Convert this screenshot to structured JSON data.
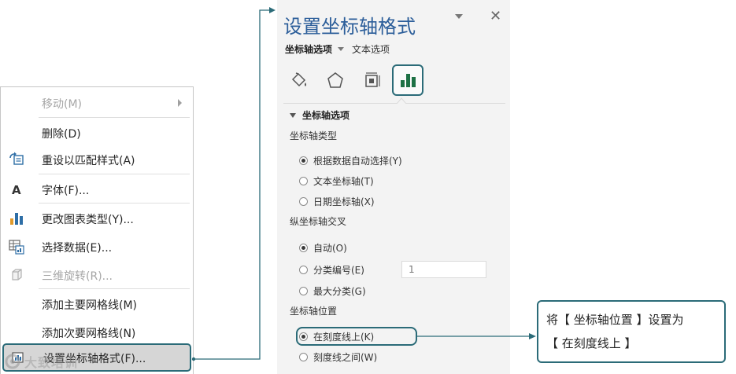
{
  "context_menu": {
    "items": [
      {
        "label": "移动(M)",
        "icon": "none",
        "disabled": true,
        "submenu": true
      },
      {
        "label": "删除(D)",
        "icon": "none",
        "disabled": false
      },
      {
        "label": "重设以匹配样式(A)",
        "icon": "reset-style-icon",
        "disabled": false
      },
      {
        "label": "字体(F)...",
        "icon": "font-icon",
        "disabled": false
      },
      {
        "label": "更改图表类型(Y)...",
        "icon": "bar-chart-icon",
        "disabled": false
      },
      {
        "label": "选择数据(E)...",
        "icon": "select-data-icon",
        "disabled": false
      },
      {
        "label": "三维旋转(R)...",
        "icon": "3d-rotation-icon",
        "disabled": true
      },
      {
        "label": "添加主要网格线(M)",
        "icon": "none",
        "disabled": false
      },
      {
        "label": "添加次要网格线(N)",
        "icon": "none",
        "disabled": false
      },
      {
        "label": "设置坐标轴格式(F)...",
        "icon": "format-axis-icon",
        "disabled": false,
        "highlighted": true
      }
    ]
  },
  "watermark": {
    "text": "大致培训"
  },
  "format_pane": {
    "title": "设置坐标轴格式",
    "close_symbol": "✕",
    "tabs": {
      "axis_options": "坐标轴选项",
      "text_options": "文本选项"
    },
    "icons": [
      "fill-line-icon",
      "effects-icon",
      "size-properties-icon",
      "axis-options-icon"
    ],
    "section_title": "坐标轴选项",
    "axis_type": {
      "label": "坐标轴类型",
      "options": [
        "根据数据自动选择(Y)",
        "文本坐标轴(T)",
        "日期坐标轴(X)"
      ],
      "selected": 0
    },
    "vertical_axis_crosses": {
      "label": "纵坐标轴交叉",
      "options": [
        "自动(O)",
        "分类编号(E)",
        "最大分类(G)"
      ],
      "selected": 0,
      "category_number_value": "1"
    },
    "axis_position": {
      "label": "坐标轴位置",
      "options": [
        "在刻度线上(K)",
        "刻度线之间(W)"
      ],
      "selected": 0
    }
  },
  "callout": {
    "line1": "将【 坐标轴位置 】设置为",
    "line2": "【 在刻度线上 】"
  },
  "colors": {
    "accent": "#2b6b78",
    "title": "#2c5e9a",
    "chart_icon": "#1e7145"
  }
}
